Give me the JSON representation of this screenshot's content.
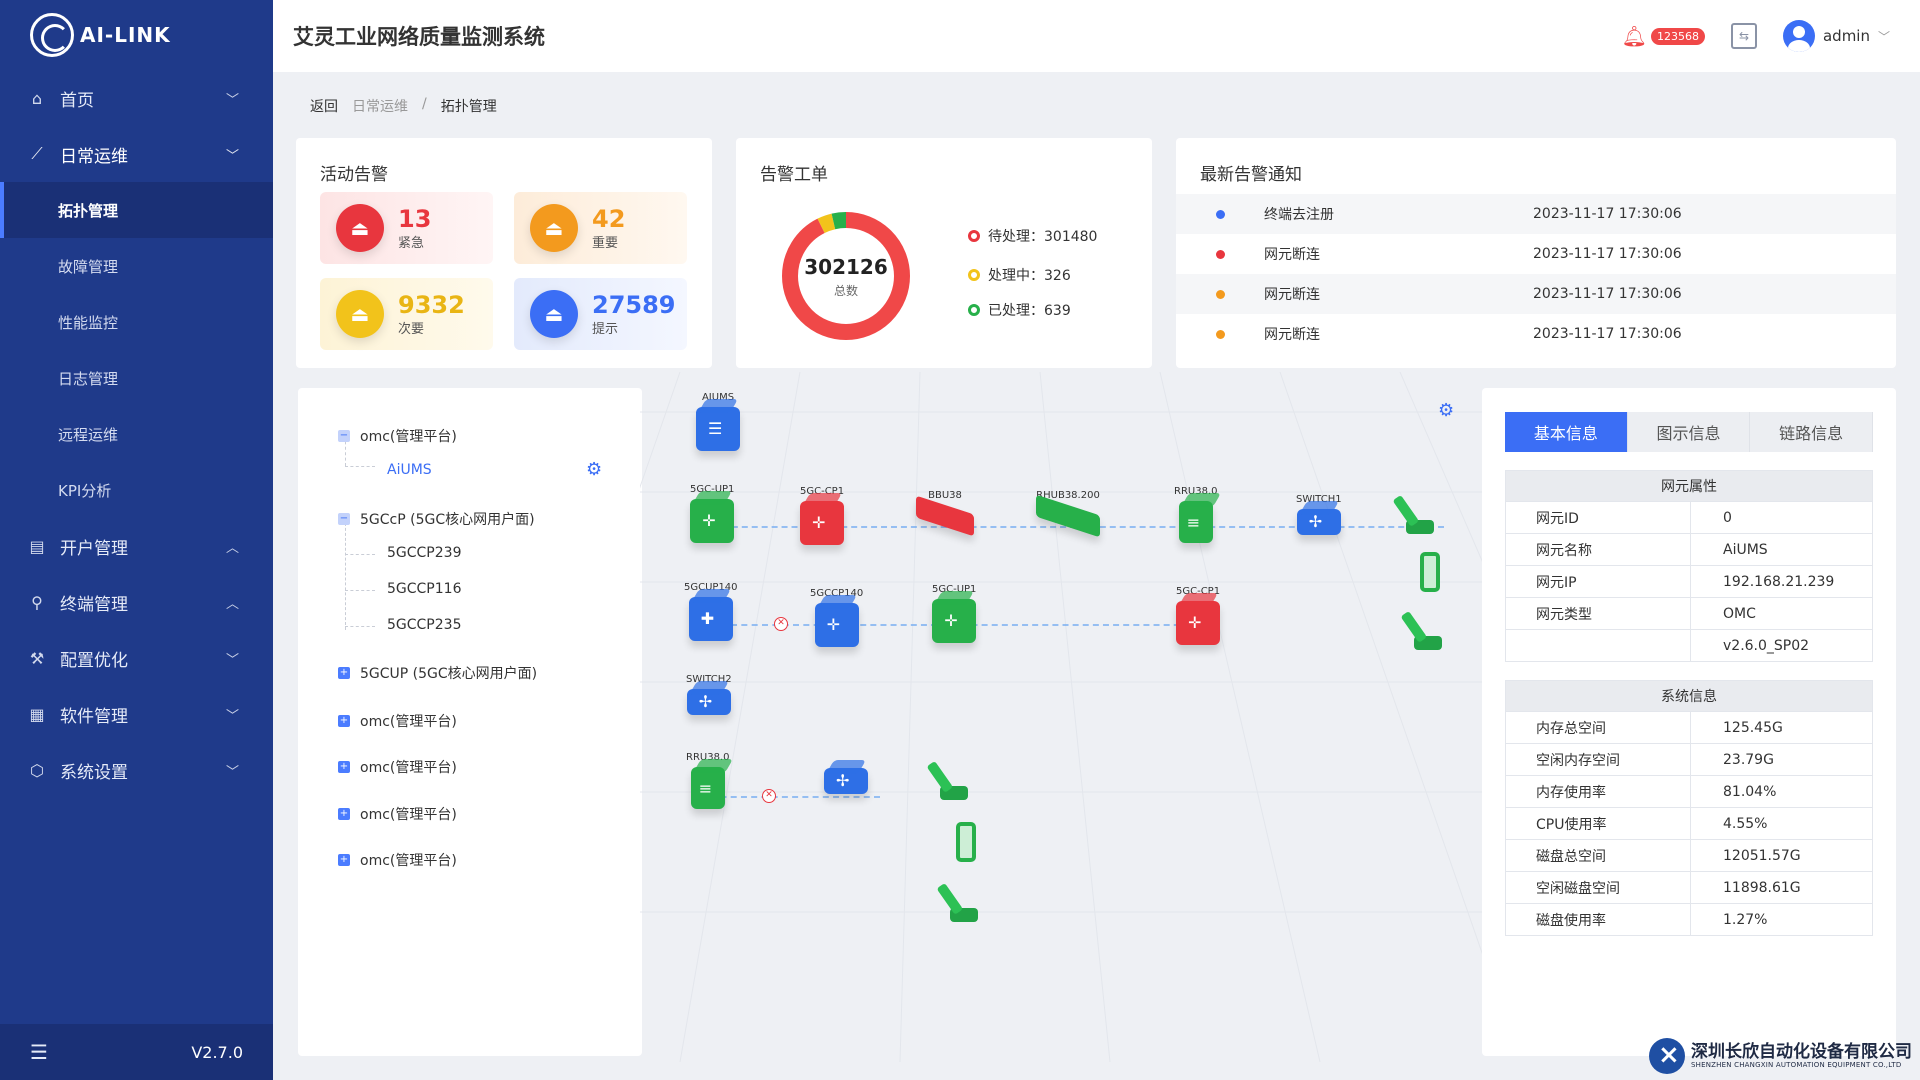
{
  "app": {
    "logo_text": "AI-LINK",
    "title": "艾灵工业网络质量监测系统",
    "version": "V2.7.0"
  },
  "header": {
    "alarm_count": "123568",
    "user": "admin"
  },
  "sidebar": {
    "items": [
      {
        "label": "首页",
        "icon": "home-icon"
      },
      {
        "label": "日常运维",
        "icon": "chart-line-icon"
      },
      {
        "label": "开户管理",
        "icon": "file-icon"
      },
      {
        "label": "终端管理",
        "icon": "terminal-icon"
      },
      {
        "label": "配置优化",
        "icon": "wrench-icon"
      },
      {
        "label": "软件管理",
        "icon": "apps-icon"
      },
      {
        "label": "系统设置",
        "icon": "settings-icon"
      }
    ],
    "sub_items": [
      "拓扑管理",
      "故障管理",
      "性能监控",
      "日志管理",
      "远程运维",
      "KPI分析"
    ]
  },
  "breadcrumb": {
    "back": "返回",
    "parent": "日常运维",
    "current": "拓扑管理"
  },
  "active_alarms": {
    "title": "活动告警",
    "items": [
      {
        "value": "13",
        "label": "紧急",
        "color": "#e8363e"
      },
      {
        "value": "42",
        "label": "重要",
        "color": "#f39a1e"
      },
      {
        "value": "9332",
        "label": "次要",
        "color": "#f2c31b"
      },
      {
        "value": "27589",
        "label": "提示",
        "color": "#3b6ef5"
      }
    ]
  },
  "work_orders": {
    "title": "告警工单",
    "total": "302126",
    "total_label": "总数",
    "legend": [
      {
        "label": "待处理：301480",
        "color": "#e8363e"
      },
      {
        "label": "处理中：326",
        "color": "#f2c31b"
      },
      {
        "label": "已处理：639",
        "color": "#27b04a"
      }
    ]
  },
  "chart_data": {
    "type": "pie",
    "categories": [
      "待处理",
      "处理中",
      "已处理"
    ],
    "values": [
      301480,
      326,
      639
    ],
    "display_note": "donut",
    "colors": [
      "#f04848",
      "#f2c31b",
      "#27b04a"
    ]
  },
  "notices": {
    "title": "最新告警通知",
    "rows": [
      {
        "msg": "终端去注册",
        "time": "2023-11-17 17:30:06",
        "color": "#3b6ef5"
      },
      {
        "msg": "网元断连",
        "time": "2023-11-17 17:30:06",
        "color": "#e8363e"
      },
      {
        "msg": "网元断连",
        "time": "2023-11-17 17:30:06",
        "color": "#f39a1e"
      },
      {
        "msg": "网元断连",
        "time": "2023-11-17 17:30:06",
        "color": "#f39a1e"
      }
    ]
  },
  "tree": {
    "nodes": [
      "omc(管理平台)",
      "AiUMS",
      "5GCcP (5GC核心网用户面)",
      "5GCCP239",
      "5GCCP116",
      "5GCCP235",
      "5GCUP (5GC核心网用户面)",
      "omc(管理平台)",
      "omc(管理平台)",
      "omc(管理平台)",
      "omc(管理平台)"
    ]
  },
  "topology": {
    "labels": [
      "AIUMS",
      "5GC-UP1",
      "5GC-CP1",
      "BBU38",
      "RHUB38.200",
      "RRU38.0",
      "SWITCH1",
      "5GCUP140",
      "5GCCP140",
      "5GC-UP1",
      "5GC-CP1",
      "SWITCH2",
      "RRU38.0"
    ]
  },
  "panel": {
    "tabs": [
      "基本信息",
      "图示信息",
      "链路信息"
    ],
    "ne_title": "网元属性",
    "ne_rows": [
      {
        "k": "网元ID",
        "v": "0"
      },
      {
        "k": "网元名称",
        "v": "AiUMS"
      },
      {
        "k": "网元IP",
        "v": "192.168.21.239"
      },
      {
        "k": "网元类型",
        "v": "OMC"
      },
      {
        "k": "",
        "v": "v2.6.0_SP02"
      }
    ],
    "sys_title": "系统信息",
    "sys_rows": [
      {
        "k": "内存总空间",
        "v": "125.45G"
      },
      {
        "k": "空闲内存空间",
        "v": "23.79G"
      },
      {
        "k": "内存使用率",
        "v": "81.04%"
      },
      {
        "k": "CPU使用率",
        "v": "4.55%"
      },
      {
        "k": "磁盘总空间",
        "v": "12051.57G"
      },
      {
        "k": "空闲磁盘空间",
        "v": "11898.61G"
      },
      {
        "k": "磁盘使用率",
        "v": "1.27%"
      }
    ]
  },
  "watermark": {
    "cn": "深圳长欣自动化设备有限公司",
    "en": "SHENZHEN CHANGXIN AUTOMATION EQUIPMENT CO.,LTD"
  }
}
